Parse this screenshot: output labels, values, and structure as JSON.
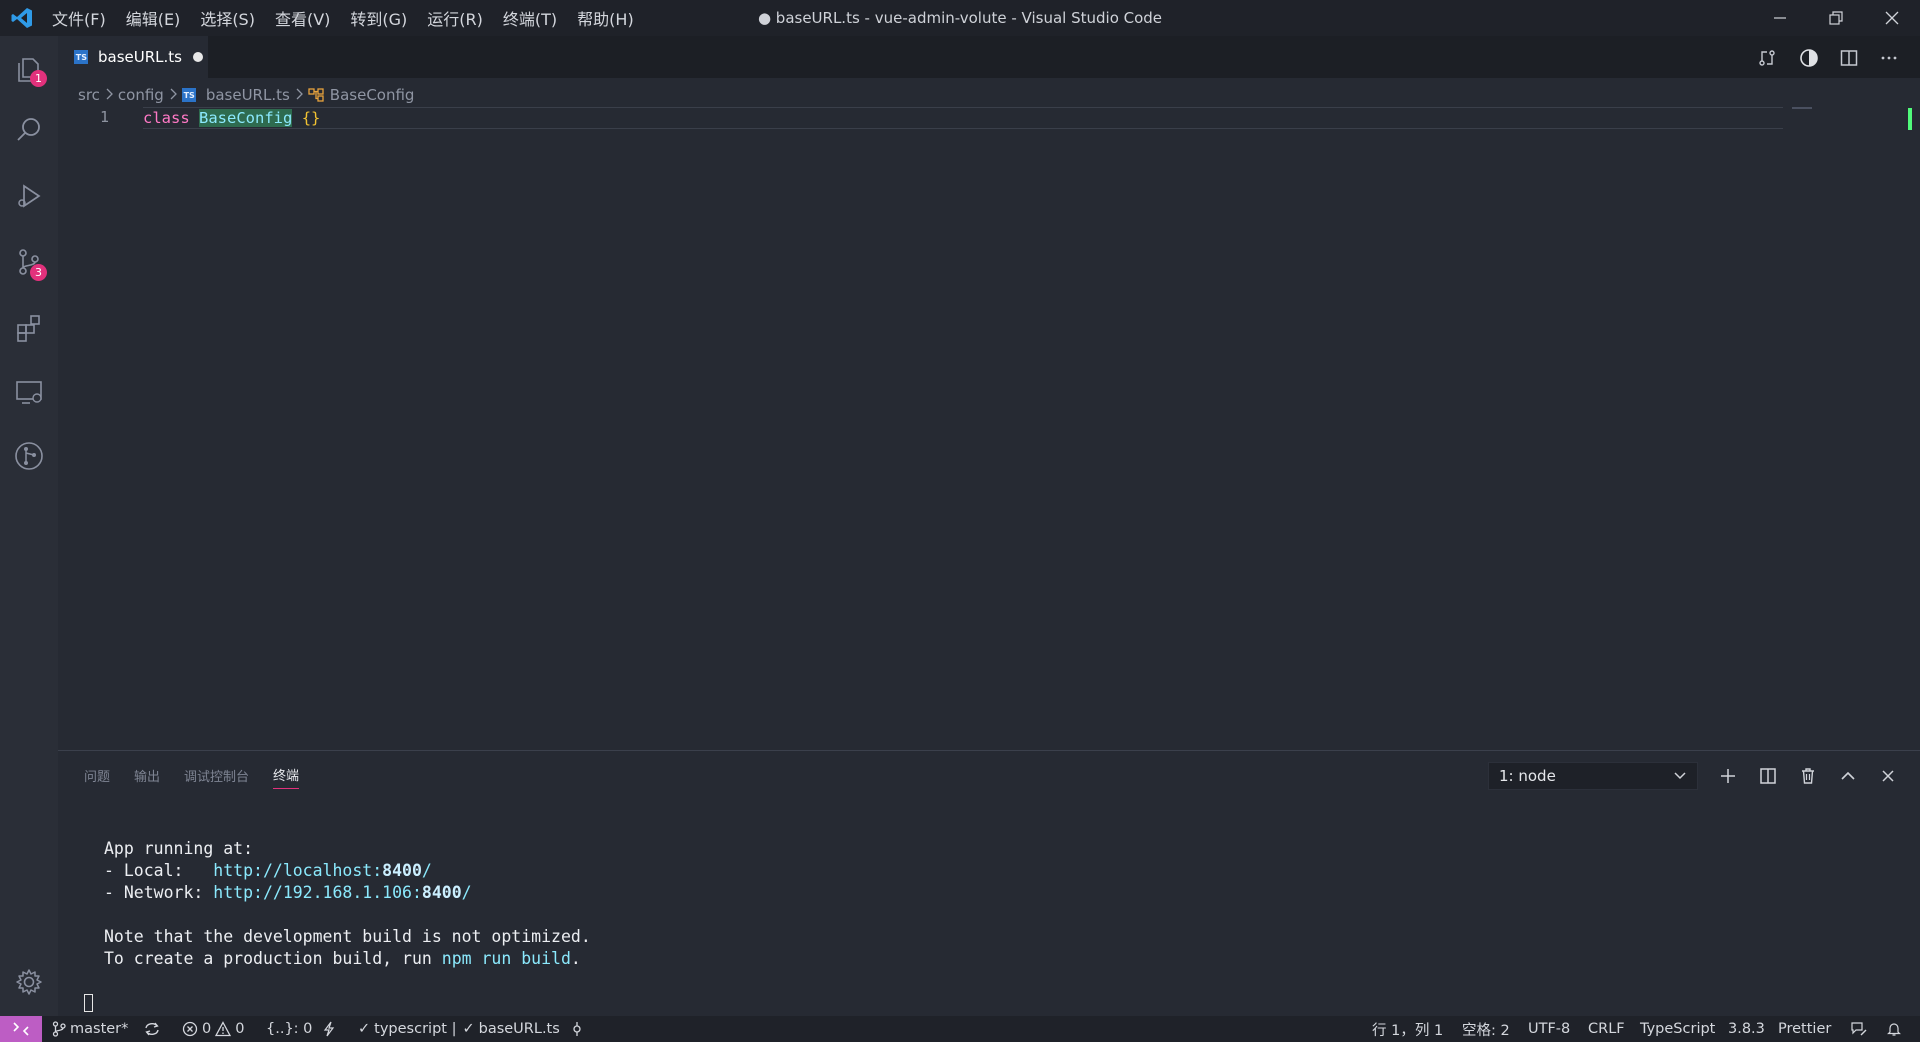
{
  "window": {
    "title": "● baseURL.ts - vue-admin-volute - Visual Studio Code"
  },
  "menu": [
    "文件(F)",
    "编辑(E)",
    "选择(S)",
    "查看(V)",
    "转到(G)",
    "运行(R)",
    "终端(T)",
    "帮助(H)"
  ],
  "activity": {
    "explorer_badge": "1",
    "scm_badge": "3"
  },
  "tab": {
    "filename": "baseURL.ts",
    "ts_icon": "TS"
  },
  "breadcrumb": {
    "src": "src",
    "config": "config",
    "file": "baseURL.ts",
    "symbol": "BaseConfig"
  },
  "editor": {
    "line_number": "1",
    "keyword": "class",
    "class_name": "BaseConfig",
    "braces": "{}"
  },
  "panel": {
    "tabs": [
      "问题",
      "输出",
      "调试控制台",
      "终端"
    ],
    "active_tab": "终端",
    "terminal_select": "1: node"
  },
  "terminal": {
    "line1": "App running at:",
    "local_label": "- Local:   ",
    "local_url": "http://localhost:",
    "local_port": "8400",
    "network_label": "- Network: ",
    "network_url": "http://192.168.1.106:",
    "network_port": "8400",
    "note": "Note that the development build is not optimized.",
    "prod_prefix": "To create a production build, run ",
    "prod_cmd": "npm run build",
    "prod_suffix": "."
  },
  "status": {
    "branch": "master*",
    "errors": "0",
    "warnings": "0",
    "brackets": "{..}: 0",
    "ts_check": "typescript | ",
    "file_check": "baseURL.ts",
    "position": "行 1，列 1",
    "spaces": "空格: 2",
    "encoding": "UTF-8",
    "eol": "CRLF",
    "language": "TypeScript",
    "version": "3.8.3",
    "formatter": "Prettier"
  },
  "colors": {
    "accent_pink": "#e2317c",
    "remote_purple": "#bd5dc4",
    "keyword": "#ff79c6",
    "class": "#8be9fd"
  }
}
